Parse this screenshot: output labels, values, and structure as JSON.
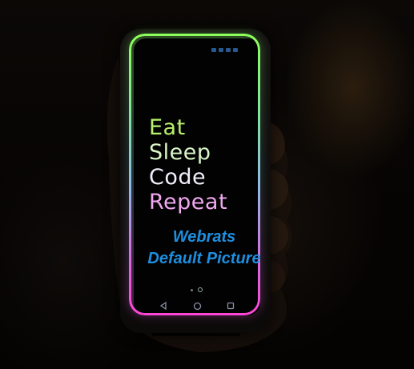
{
  "screen": {
    "slogan_lines": [
      "Eat",
      "Sleep",
      "Code",
      "Repeat"
    ]
  },
  "watermark": {
    "line1": "Webrats",
    "line2": "Default Picture"
  },
  "icons": {
    "back": "back-triangle-icon",
    "home": "home-circle-icon",
    "recents": "recents-square-icon"
  },
  "colors": {
    "neon_green": "#8dff5a",
    "neon_pink": "#ff46d6",
    "watermark_blue": "#1e8fe0"
  }
}
